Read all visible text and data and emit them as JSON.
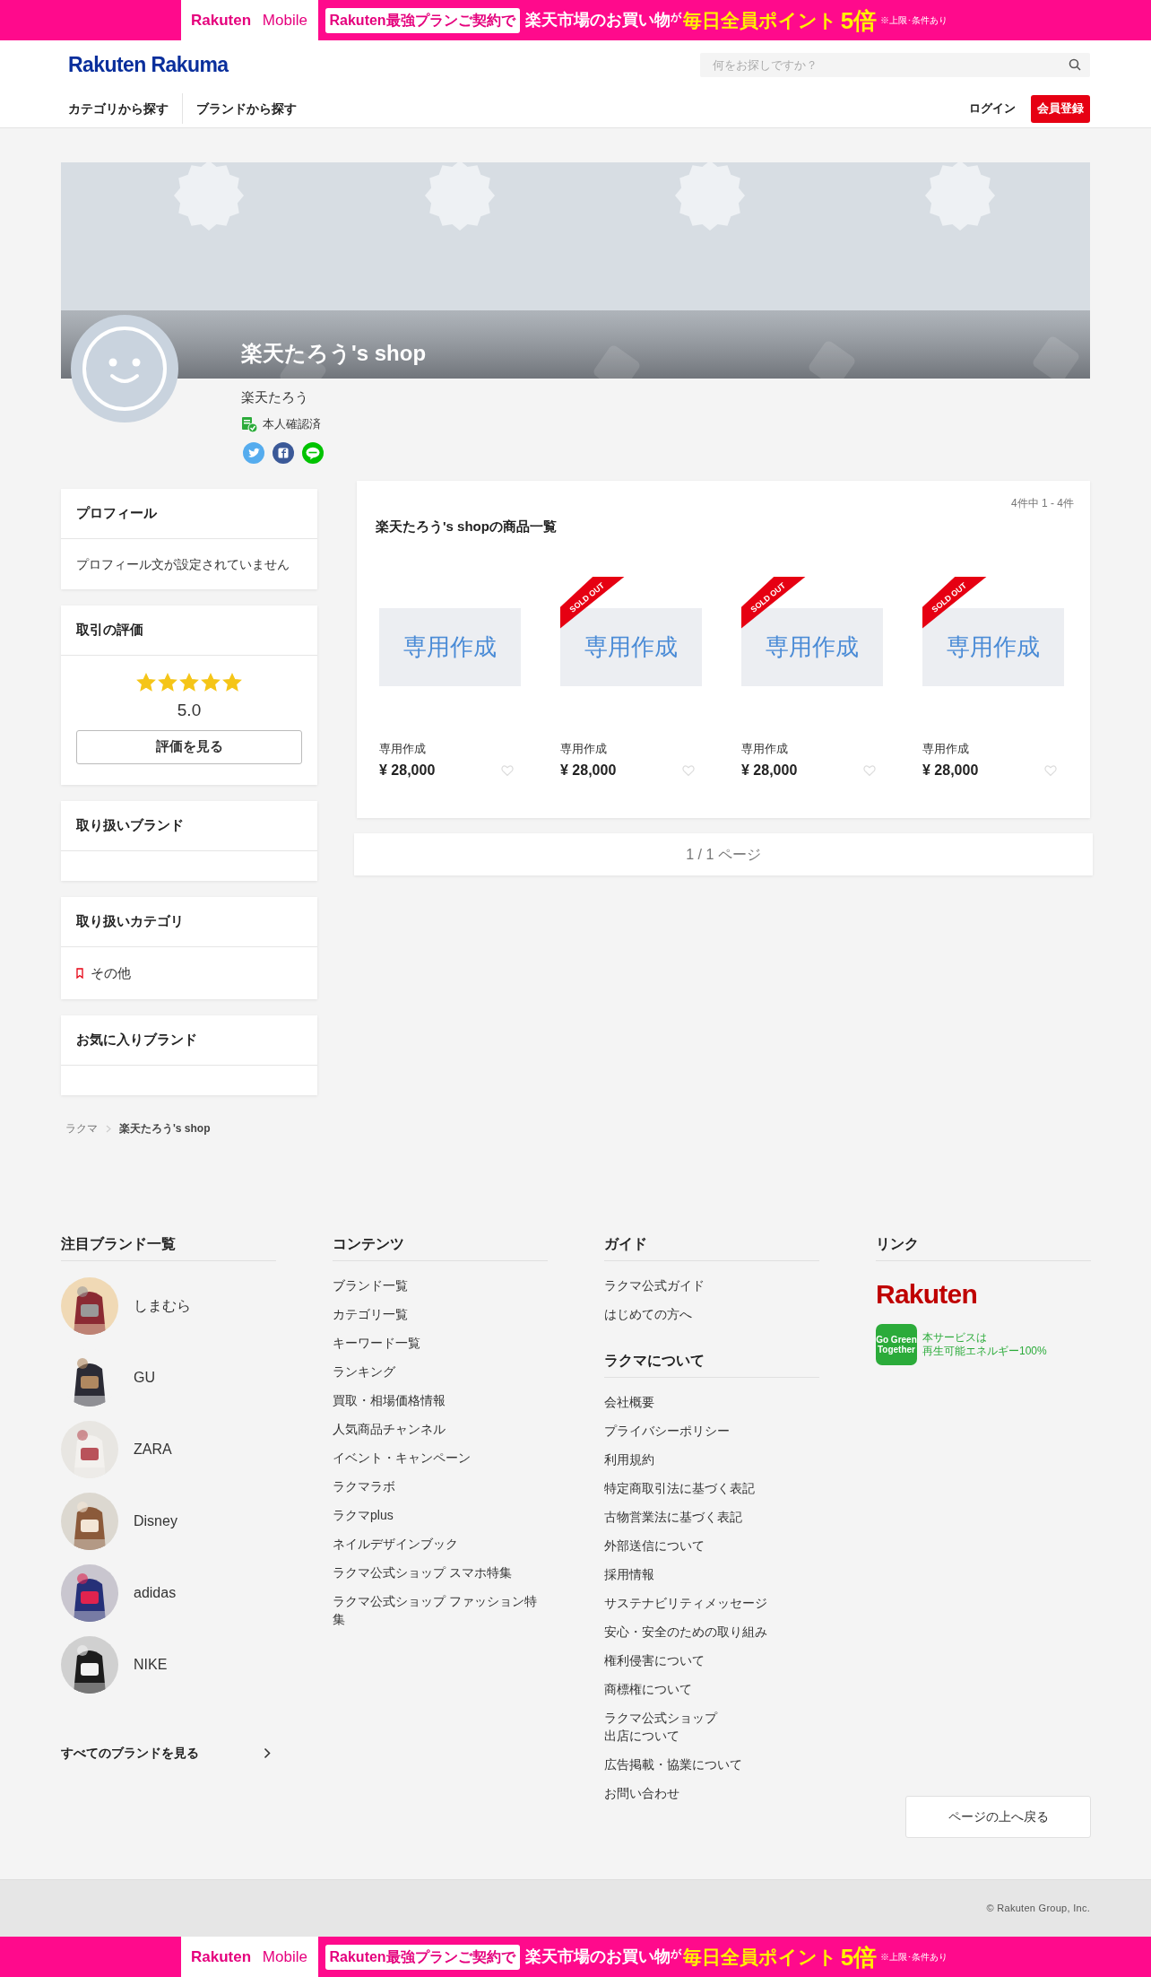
{
  "top_banner": {
    "logo": "**Rakuten** Mobile",
    "segments": [
      {
        "text": "Rakuten最強プランご契約で",
        "kind": "pill"
      },
      {
        "text": "楽天市場のお買い物",
        "kind": "white"
      },
      {
        "text": "が",
        "kind": "small"
      },
      {
        "text": "毎日全員ポイント",
        "kind": "yellow"
      },
      {
        "text": "5倍",
        "kind": "big"
      },
      {
        "text": "※上限･条件あり",
        "kind": "note"
      }
    ]
  },
  "header": {
    "logo": "Rakuten Rakuma",
    "search": {
      "placeholder": "何をお探しですか？"
    },
    "nav": [
      "カテゴリから探す",
      "ブランドから探す"
    ],
    "login": "ログイン",
    "signup": "会員登録"
  },
  "shop": {
    "name": "楽天たろう's shop",
    "user": "楽天たろう",
    "verified": "本人確認済"
  },
  "sidebar": [
    {
      "kind": "text",
      "title": "プロフィール",
      "body": "プロフィール文が設定されていません"
    },
    {
      "kind": "rating",
      "title": "取引の評価",
      "stars": 5,
      "score": "5.0",
      "button": "評価を見る"
    },
    {
      "kind": "empty",
      "title": "取り扱いブランド"
    },
    {
      "kind": "list",
      "title": "取り扱いカテゴリ",
      "items": [
        "その他"
      ]
    },
    {
      "kind": "empty",
      "title": "お気に入りブランド"
    }
  ],
  "products": {
    "title": "楽天たろう's shopの商品一覧",
    "count": "4件中 1 - 4件",
    "items": [
      {
        "image_text": "専用作成",
        "name": "専用作成",
        "price": "¥ 28,000"
      },
      {
        "image_text": "専用作成",
        "name": "専用作成",
        "price": "¥ 28,000",
        "ribbon": "SOLD OUT"
      },
      {
        "image_text": "専用作成",
        "name": "専用作成",
        "price": "¥ 28,000",
        "ribbon": "SOLD OUT"
      },
      {
        "image_text": "専用作成",
        "name": "専用作成",
        "price": "¥ 28,000",
        "ribbon": "SOLD OUT"
      }
    ]
  },
  "pagination": "1 / 1 ページ",
  "breadcrumb": [
    {
      "label": "ラクマ",
      "current": false
    },
    {
      "label": "楽天たろう's shop",
      "current": true
    }
  ],
  "footer": {
    "brands": {
      "title": "注目ブランド一覧",
      "items": [
        "しまむら",
        "GU",
        "ZARA",
        "Disney",
        "adidas",
        "NIKE"
      ],
      "more": "すべてのブランドを見る"
    },
    "contents": {
      "title": "コンテンツ",
      "links": [
        "ブランド一覧",
        "カテゴリ一覧",
        "キーワード一覧",
        "ランキング",
        "買取・相場価格情報",
        "人気商品チャンネル",
        "イベント・キャンペーン",
        "ラクマラボ",
        "ラクマplus",
        "ネイルデザインブック",
        "ラクマ公式ショップ スマホ特集",
        "ラクマ公式ショップ ファッション特集"
      ]
    },
    "guide": {
      "title": "ガイド",
      "links": [
        "ラクマ公式ガイド",
        "はじめての方へ"
      ]
    },
    "about": {
      "title": "ラクマについて",
      "links": [
        "会社概要",
        "プライバシーポリシー",
        "利用規約",
        "特定商取引法に基づく表記",
        "古物営業法に基づく表記",
        "外部送信について",
        "採用情報",
        "サステナビリティメッセージ",
        "安心・安全のための取り組み",
        "権利侵害について",
        "商標権について",
        [
          "ラクマ公式ショップ",
          "出店について"
        ],
        "広告掲載・協業について",
        "お問い合わせ"
      ]
    },
    "links": {
      "title": "リンク",
      "rakuten_logo": "Rakuten",
      "green_badge": "Go Green Together",
      "green_text": [
        "本サービスは",
        "再生可能エネルギー100%"
      ]
    },
    "back_to_top": "ページの上へ戻る"
  },
  "copyright": "© Rakuten Group, Inc.",
  "bottom_banner": {
    "logo": "**Rakuten** Mobile",
    "segments": [
      {
        "text": "Rakuten最強プランご契約で",
        "kind": "pill"
      },
      {
        "text": "楽天市場のお買い物",
        "kind": "white"
      },
      {
        "text": "が",
        "kind": "small"
      },
      {
        "text": "毎日全員ポイント",
        "kind": "yellow"
      },
      {
        "text": "5倍",
        "kind": "big"
      },
      {
        "text": "※上限･条件あり",
        "kind": "note"
      }
    ]
  }
}
